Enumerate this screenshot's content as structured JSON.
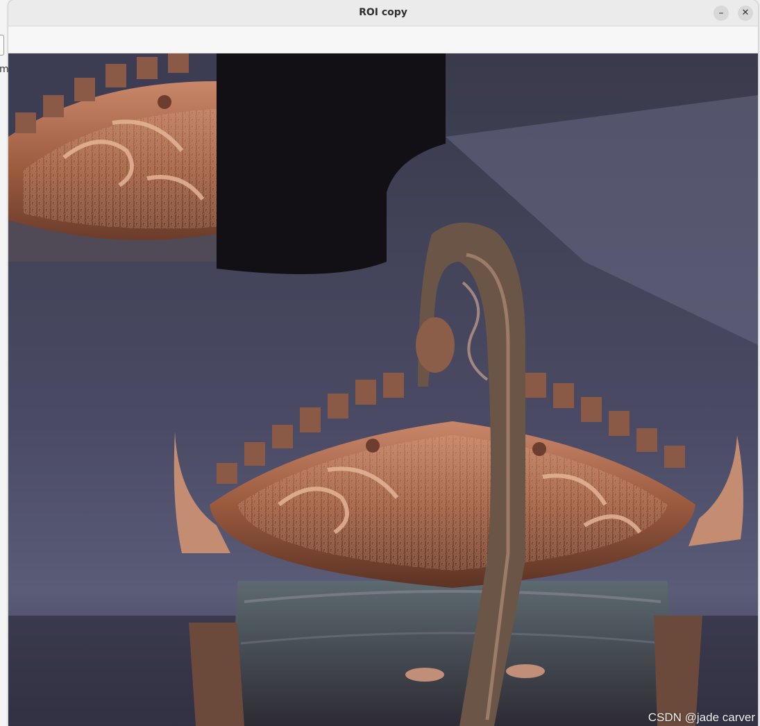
{
  "window": {
    "title": "ROI copy",
    "minimize_label": "–",
    "close_label": "✕"
  },
  "left_edge": {
    "text": "m"
  },
  "image": {
    "subject": "bronze vessel with ornate lid and handle",
    "colors": {
      "bronze": "#9a5a3e",
      "patina": "#5d6a55",
      "background": "#3c3c52"
    }
  },
  "watermark": "CSDN @jade carver"
}
